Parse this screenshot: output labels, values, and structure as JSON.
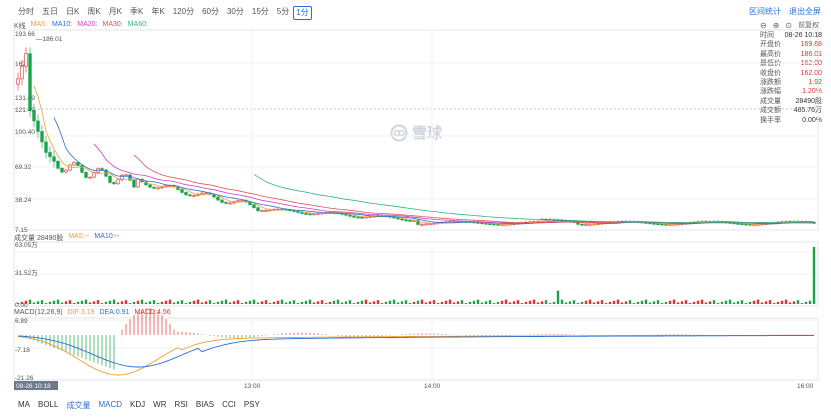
{
  "periods": [
    {
      "label": "分时",
      "active": false
    },
    {
      "label": "五日",
      "active": false
    },
    {
      "label": "日K",
      "active": false
    },
    {
      "label": "周K",
      "active": false
    },
    {
      "label": "月K",
      "active": false
    },
    {
      "label": "季K",
      "active": false
    },
    {
      "label": "年K",
      "active": false
    },
    {
      "label": "120分",
      "active": false
    },
    {
      "label": "60分",
      "active": false
    },
    {
      "label": "30分",
      "active": false
    },
    {
      "label": "15分",
      "active": false
    },
    {
      "label": "5分",
      "active": false
    },
    {
      "label": "1分",
      "active": true
    }
  ],
  "top_right": {
    "stats": "区间统计",
    "exit_fullscreen": "退出全屏"
  },
  "kline": {
    "title": "K线",
    "ma": [
      {
        "name": "MA5:",
        "color": "#f0a030"
      },
      {
        "name": "MA10:",
        "color": "#2a6fd6"
      },
      {
        "name": "MA20:",
        "color": "#d040c0"
      },
      {
        "name": "MA30:",
        "color": "#e05050"
      },
      {
        "name": "MA60:",
        "color": "#30b080"
      }
    ],
    "y_labels": [
      "193.66",
      "162",
      "131.49",
      "121.49",
      "100.40",
      "69.32",
      "38.24",
      "7.15"
    ],
    "high_label": "186.01",
    "low_label": "7.15"
  },
  "adjust": {
    "label": "前复权"
  },
  "info": [
    {
      "label": "时间",
      "value": "08-26 10:18",
      "red": false
    },
    {
      "label": "开盘价",
      "value": "169.68",
      "red": true
    },
    {
      "label": "最高价",
      "value": "186.01",
      "red": true
    },
    {
      "label": "最低价",
      "value": "162.00",
      "red": true
    },
    {
      "label": "收盘价",
      "value": "162.00",
      "red": true
    },
    {
      "label": "涨跌额",
      "value": "1.92",
      "red": true
    },
    {
      "label": "涨跌幅",
      "value": "1.20%",
      "red": true
    },
    {
      "label": "成交量",
      "value": "28490股",
      "red": false
    },
    {
      "label": "成交额",
      "value": "485.76万",
      "red": false
    },
    {
      "label": "换手率",
      "value": "0.00%",
      "red": false
    }
  ],
  "volume": {
    "title": "成交量 28490股",
    "ma": [
      {
        "name": "MA5:--",
        "color": "#f0a030"
      },
      {
        "name": "MA10:--",
        "color": "#2a6fd6"
      }
    ],
    "y_labels": [
      "63.05万",
      "31.52万",
      "0.00"
    ]
  },
  "macd": {
    "title": "MACD(12,26,9)",
    "items": [
      {
        "name": "DIF:3.19",
        "color": "#f0a030"
      },
      {
        "name": "DEA:0.91",
        "color": "#2a6fd6"
      },
      {
        "name": "MACD:4.56",
        "color": "#e23030"
      }
    ],
    "y_labels": [
      "6.89",
      "-7.18",
      "-21.26"
    ]
  },
  "time_labels": [
    "08-26 10:18",
    "13:00",
    "14:00",
    "16:00"
  ],
  "watermark": "雪球",
  "indicator_tabs": [
    {
      "label": "MA",
      "active": false
    },
    {
      "label": "BOLL",
      "active": false
    },
    {
      "label": "成交量",
      "active": true
    },
    {
      "label": "MACD",
      "active": true
    },
    {
      "label": "KDJ",
      "active": false
    },
    {
      "label": "WR",
      "active": false
    },
    {
      "label": "RSI",
      "active": false
    },
    {
      "label": "BIAS",
      "active": false
    },
    {
      "label": "CCI",
      "active": false
    },
    {
      "label": "PSY",
      "active": false
    }
  ]
}
